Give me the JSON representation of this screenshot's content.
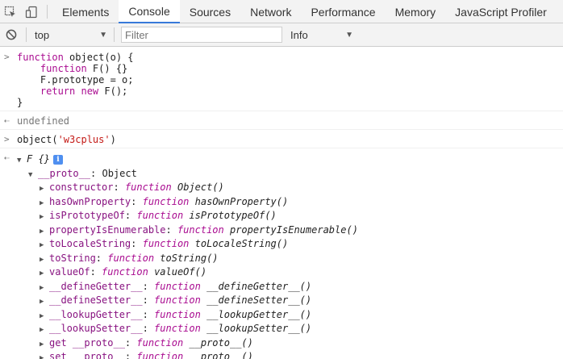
{
  "tabs": [
    "Elements",
    "Console",
    "Sources",
    "Network",
    "Performance",
    "Memory",
    "JavaScript Profiler"
  ],
  "active_tab": "Console",
  "filterbar": {
    "context": "top",
    "filter_placeholder": "Filter",
    "level": "Info"
  },
  "console": {
    "input1": {
      "lines": [
        [
          "function",
          " object(o) {"
        ],
        [
          "    function",
          " F() {}"
        ],
        [
          "    ",
          "F.prototype = o;"
        ],
        [
          "    return new",
          " F();"
        ],
        [
          "",
          "}"
        ]
      ]
    },
    "result1": "undefined",
    "input2_prefix": "object(",
    "input2_string": "'w3cplus'",
    "input2_suffix": ")",
    "result2_label": "F {}",
    "proto_key": "__proto__",
    "proto_value": "Object",
    "properties": [
      {
        "name": "constructor",
        "keyword": "function",
        "value": "Object()"
      },
      {
        "name": "hasOwnProperty",
        "keyword": "function",
        "value": "hasOwnProperty()"
      },
      {
        "name": "isPrototypeOf",
        "keyword": "function",
        "value": "isPrototypeOf()"
      },
      {
        "name": "propertyIsEnumerable",
        "keyword": "function",
        "value": "propertyIsEnumerable()"
      },
      {
        "name": "toLocaleString",
        "keyword": "function",
        "value": "toLocaleString()"
      },
      {
        "name": "toString",
        "keyword": "function",
        "value": "toString()"
      },
      {
        "name": "valueOf",
        "keyword": "function",
        "value": "valueOf()"
      },
      {
        "name": "__defineGetter__",
        "keyword": "function",
        "value": "__defineGetter__()"
      },
      {
        "name": "__defineSetter__",
        "keyword": "function",
        "value": "__defineSetter__()"
      },
      {
        "name": "__lookupGetter__",
        "keyword": "function",
        "value": "__lookupGetter__()"
      },
      {
        "name": "__lookupSetter__",
        "keyword": "function",
        "value": "__lookupSetter__()"
      },
      {
        "name": "get __proto__",
        "keyword": "function",
        "value": "__proto__()"
      },
      {
        "name": "set __proto__",
        "keyword": "function",
        "value": "__proto__()"
      }
    ]
  },
  "colors": {
    "keyword": "#aa0d91",
    "string": "#c41a16",
    "property": "#881280",
    "active_tab_underline": "#3879d9",
    "info_badge": "#4f8ff0"
  }
}
